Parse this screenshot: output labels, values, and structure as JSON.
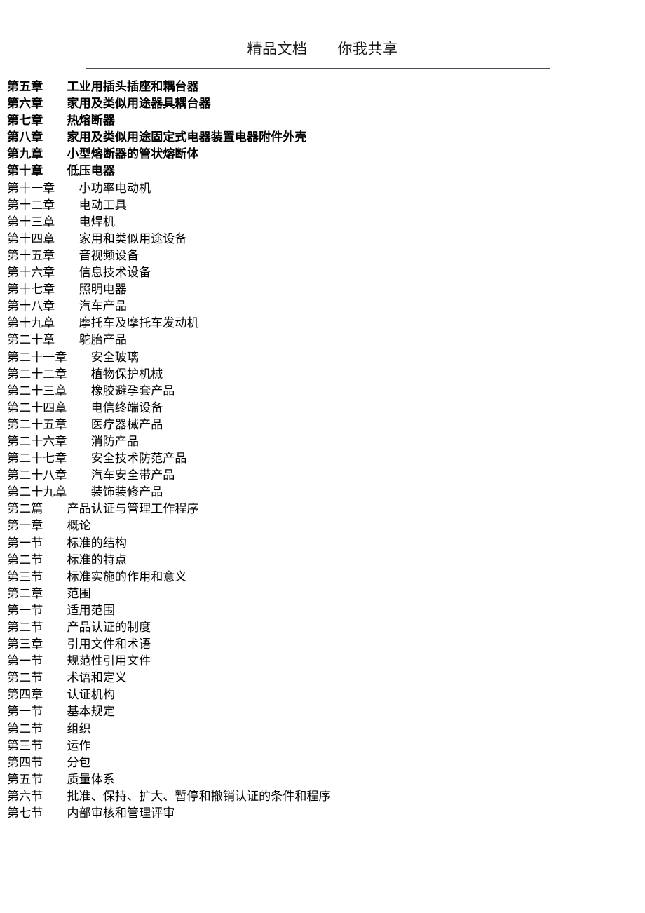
{
  "header": {
    "text": "精品文档　　你我共享",
    "left_phrase": "精品文档",
    "right_phrase": "你我共享",
    "rule_color": "#4a4a55"
  },
  "toc": {
    "gap": "　　",
    "lines": [
      {
        "label": "第五章",
        "title": "工业用插头插座和耦台器",
        "bold": true
      },
      {
        "label": "第六章",
        "title": "家用及类似用途器具耦台器",
        "bold": true
      },
      {
        "label": "第七章",
        "title": "热熔断器",
        "bold": true
      },
      {
        "label": "第八章",
        "title": "家用及类似用途固定式电器装置电器附件外壳",
        "bold": true
      },
      {
        "label": "第九章",
        "title": "小型熔断器的管状熔断体",
        "bold": true
      },
      {
        "label": "第十章",
        "title": "低压电器",
        "bold": true
      },
      {
        "label": "第十一章",
        "title": "小功率电动机",
        "bold": false
      },
      {
        "label": "第十二章",
        "title": "电动工具",
        "bold": false
      },
      {
        "label": "第十三章",
        "title": "电焊机",
        "bold": false
      },
      {
        "label": "第十四章",
        "title": "家用和类似用途设备",
        "bold": false
      },
      {
        "label": "第十五章",
        "title": "音视频设备",
        "bold": false
      },
      {
        "label": "第十六章",
        "title": "信息技术设备",
        "bold": false
      },
      {
        "label": "第十七章",
        "title": "照明电器",
        "bold": false
      },
      {
        "label": "第十八章",
        "title": "汽车产品",
        "bold": false
      },
      {
        "label": "第十九章",
        "title": "摩托车及摩托车发动机",
        "bold": false
      },
      {
        "label": "第二十章",
        "title": "鸵胎产品",
        "bold": false
      },
      {
        "label": "第二十一章",
        "title": "安全玻璃",
        "bold": false
      },
      {
        "label": "第二十二章",
        "title": "植物保护机械",
        "bold": false
      },
      {
        "label": "第二十三章",
        "title": "橡胶避孕套产品",
        "bold": false
      },
      {
        "label": "第二十四章",
        "title": "电信终端设备",
        "bold": false
      },
      {
        "label": "第二十五章",
        "title": "医疗器械产品",
        "bold": false
      },
      {
        "label": "第二十六章",
        "title": "消防产品",
        "bold": false
      },
      {
        "label": "第二十七章",
        "title": "安全技术防范产品",
        "bold": false
      },
      {
        "label": "第二十八章",
        "title": "汽车安全带产品",
        "bold": false
      },
      {
        "label": "第二十九章",
        "title": "装饰装修产品",
        "bold": false
      },
      {
        "label": "第二篇",
        "title": "产品认证与管理工作程序",
        "bold": false
      },
      {
        "label": "第一章",
        "title": "概论",
        "bold": false
      },
      {
        "label": "第一节",
        "title": "标准的结构",
        "bold": false
      },
      {
        "label": "第二节",
        "title": "标准的特点",
        "bold": false
      },
      {
        "label": "第三节",
        "title": "标准实施的作用和意义",
        "bold": false
      },
      {
        "label": "第二章",
        "title": "范围",
        "bold": false
      },
      {
        "label": "第一节",
        "title": "适用范围",
        "bold": false
      },
      {
        "label": "第二节",
        "title": "产品认证的制度",
        "bold": false
      },
      {
        "label": "第三章",
        "title": "引用文件和术语",
        "bold": false
      },
      {
        "label": "第一节",
        "title": "规范性引用文件",
        "bold": false
      },
      {
        "label": "第二节",
        "title": "术语和定义",
        "bold": false
      },
      {
        "label": "第四章",
        "title": "认证机构",
        "bold": false
      },
      {
        "label": "第一节",
        "title": "基本规定",
        "bold": false
      },
      {
        "label": "第二节",
        "title": "组织",
        "bold": false
      },
      {
        "label": "第三节",
        "title": "运作",
        "bold": false
      },
      {
        "label": "第四节",
        "title": "分包",
        "bold": false
      },
      {
        "label": "第五节",
        "title": "质量体系",
        "bold": false
      },
      {
        "label": "第六节",
        "title": "批准、保持、扩大、暂停和撤销认证的条件和程序",
        "bold": false
      },
      {
        "label": "第七节",
        "title": "内部审核和管理评审",
        "bold": false
      }
    ]
  }
}
